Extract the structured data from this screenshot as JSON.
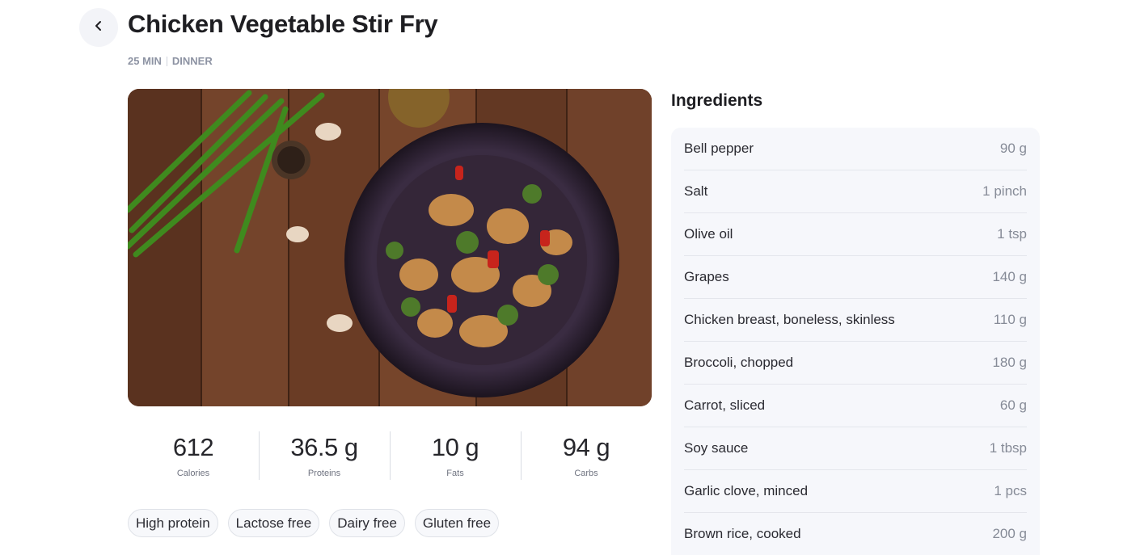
{
  "header": {
    "title": "Chicken Vegetable Stir Fry",
    "time": "25 MIN",
    "category": "DINNER"
  },
  "nutrition": [
    {
      "value": "612",
      "label": "Calories"
    },
    {
      "value": "36.5 g",
      "label": "Proteins"
    },
    {
      "value": "10 g",
      "label": "Fats"
    },
    {
      "value": "94 g",
      "label": "Carbs"
    }
  ],
  "tags": [
    "High protein",
    "Lactose free",
    "Dairy free",
    "Gluten free"
  ],
  "ingredients": {
    "title": "Ingredients",
    "items": [
      {
        "name": "Bell pepper",
        "qty": "90 g"
      },
      {
        "name": "Salt",
        "qty": "1 pinch"
      },
      {
        "name": "Olive oil",
        "qty": "1 tsp"
      },
      {
        "name": "Grapes",
        "qty": "140 g"
      },
      {
        "name": "Chicken breast, boneless, skinless",
        "qty": "110 g"
      },
      {
        "name": "Broccoli, chopped",
        "qty": "180 g"
      },
      {
        "name": "Carrot, sliced",
        "qty": "60 g"
      },
      {
        "name": "Soy sauce",
        "qty": "1 tbsp"
      },
      {
        "name": "Garlic clove, minced",
        "qty": "1 pcs"
      },
      {
        "name": "Brown rice, cooked",
        "qty": "200 g"
      }
    ]
  },
  "icons": {
    "back": "chevron-left-icon"
  }
}
